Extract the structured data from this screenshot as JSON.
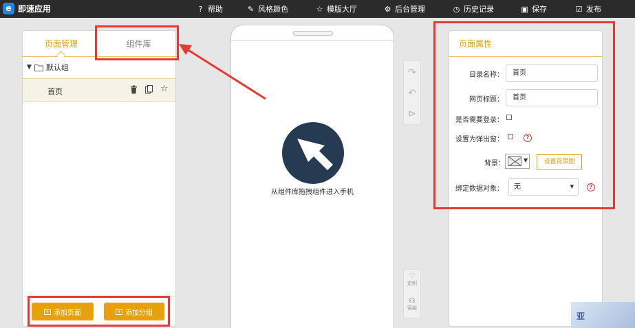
{
  "app": {
    "logo_letter": "e",
    "title": "即速应用"
  },
  "nav": [
    {
      "icon": "help-icon",
      "glyph": "?",
      "label": "帮助"
    },
    {
      "icon": "palette-icon",
      "glyph": "✎",
      "label": "风格颜色"
    },
    {
      "icon": "star-icon",
      "glyph": "☆",
      "label": "模版大厅"
    },
    {
      "icon": "gear-icon",
      "glyph": "⚙",
      "label": "后台管理"
    },
    {
      "icon": "history-icon",
      "glyph": "◷",
      "label": "历史记录"
    },
    {
      "icon": "save-icon",
      "glyph": "▣",
      "label": "保存"
    },
    {
      "icon": "publish-icon",
      "glyph": "☑",
      "label": "发布"
    }
  ],
  "left_panel": {
    "tabs": [
      {
        "label": "页面管理",
        "active": true
      },
      {
        "label": "组件库",
        "active": false
      }
    ],
    "group": {
      "label": "默认组"
    },
    "pages": [
      {
        "label": "首页"
      }
    ],
    "footer": {
      "add_page": "添加页面",
      "add_group": "添加分组"
    }
  },
  "phone": {
    "hint": "从组件库拖拽组件进入手机"
  },
  "side_tools": [
    {
      "icon": "customize-icon",
      "label": "定制"
    },
    {
      "icon": "customer-service-icon",
      "label": "客服"
    }
  ],
  "right_panel": {
    "title": "页面属性",
    "fields": {
      "dir_name": {
        "label": "目录名称：",
        "value": "首页"
      },
      "page_title": {
        "label": "网页标题：",
        "value": "首页"
      },
      "need_login": {
        "label": "是否需要登录："
      },
      "popup": {
        "label": "设置为弹出窗："
      },
      "background": {
        "label": "背景：",
        "button": "设置背景图"
      },
      "bind_data": {
        "label": "绑定数据对象：",
        "value": "无"
      }
    }
  },
  "colors": {
    "accent": "#e7a10d",
    "topbar": "#2b2b2b",
    "annotation": "#e53935",
    "circle": "#263a52"
  }
}
